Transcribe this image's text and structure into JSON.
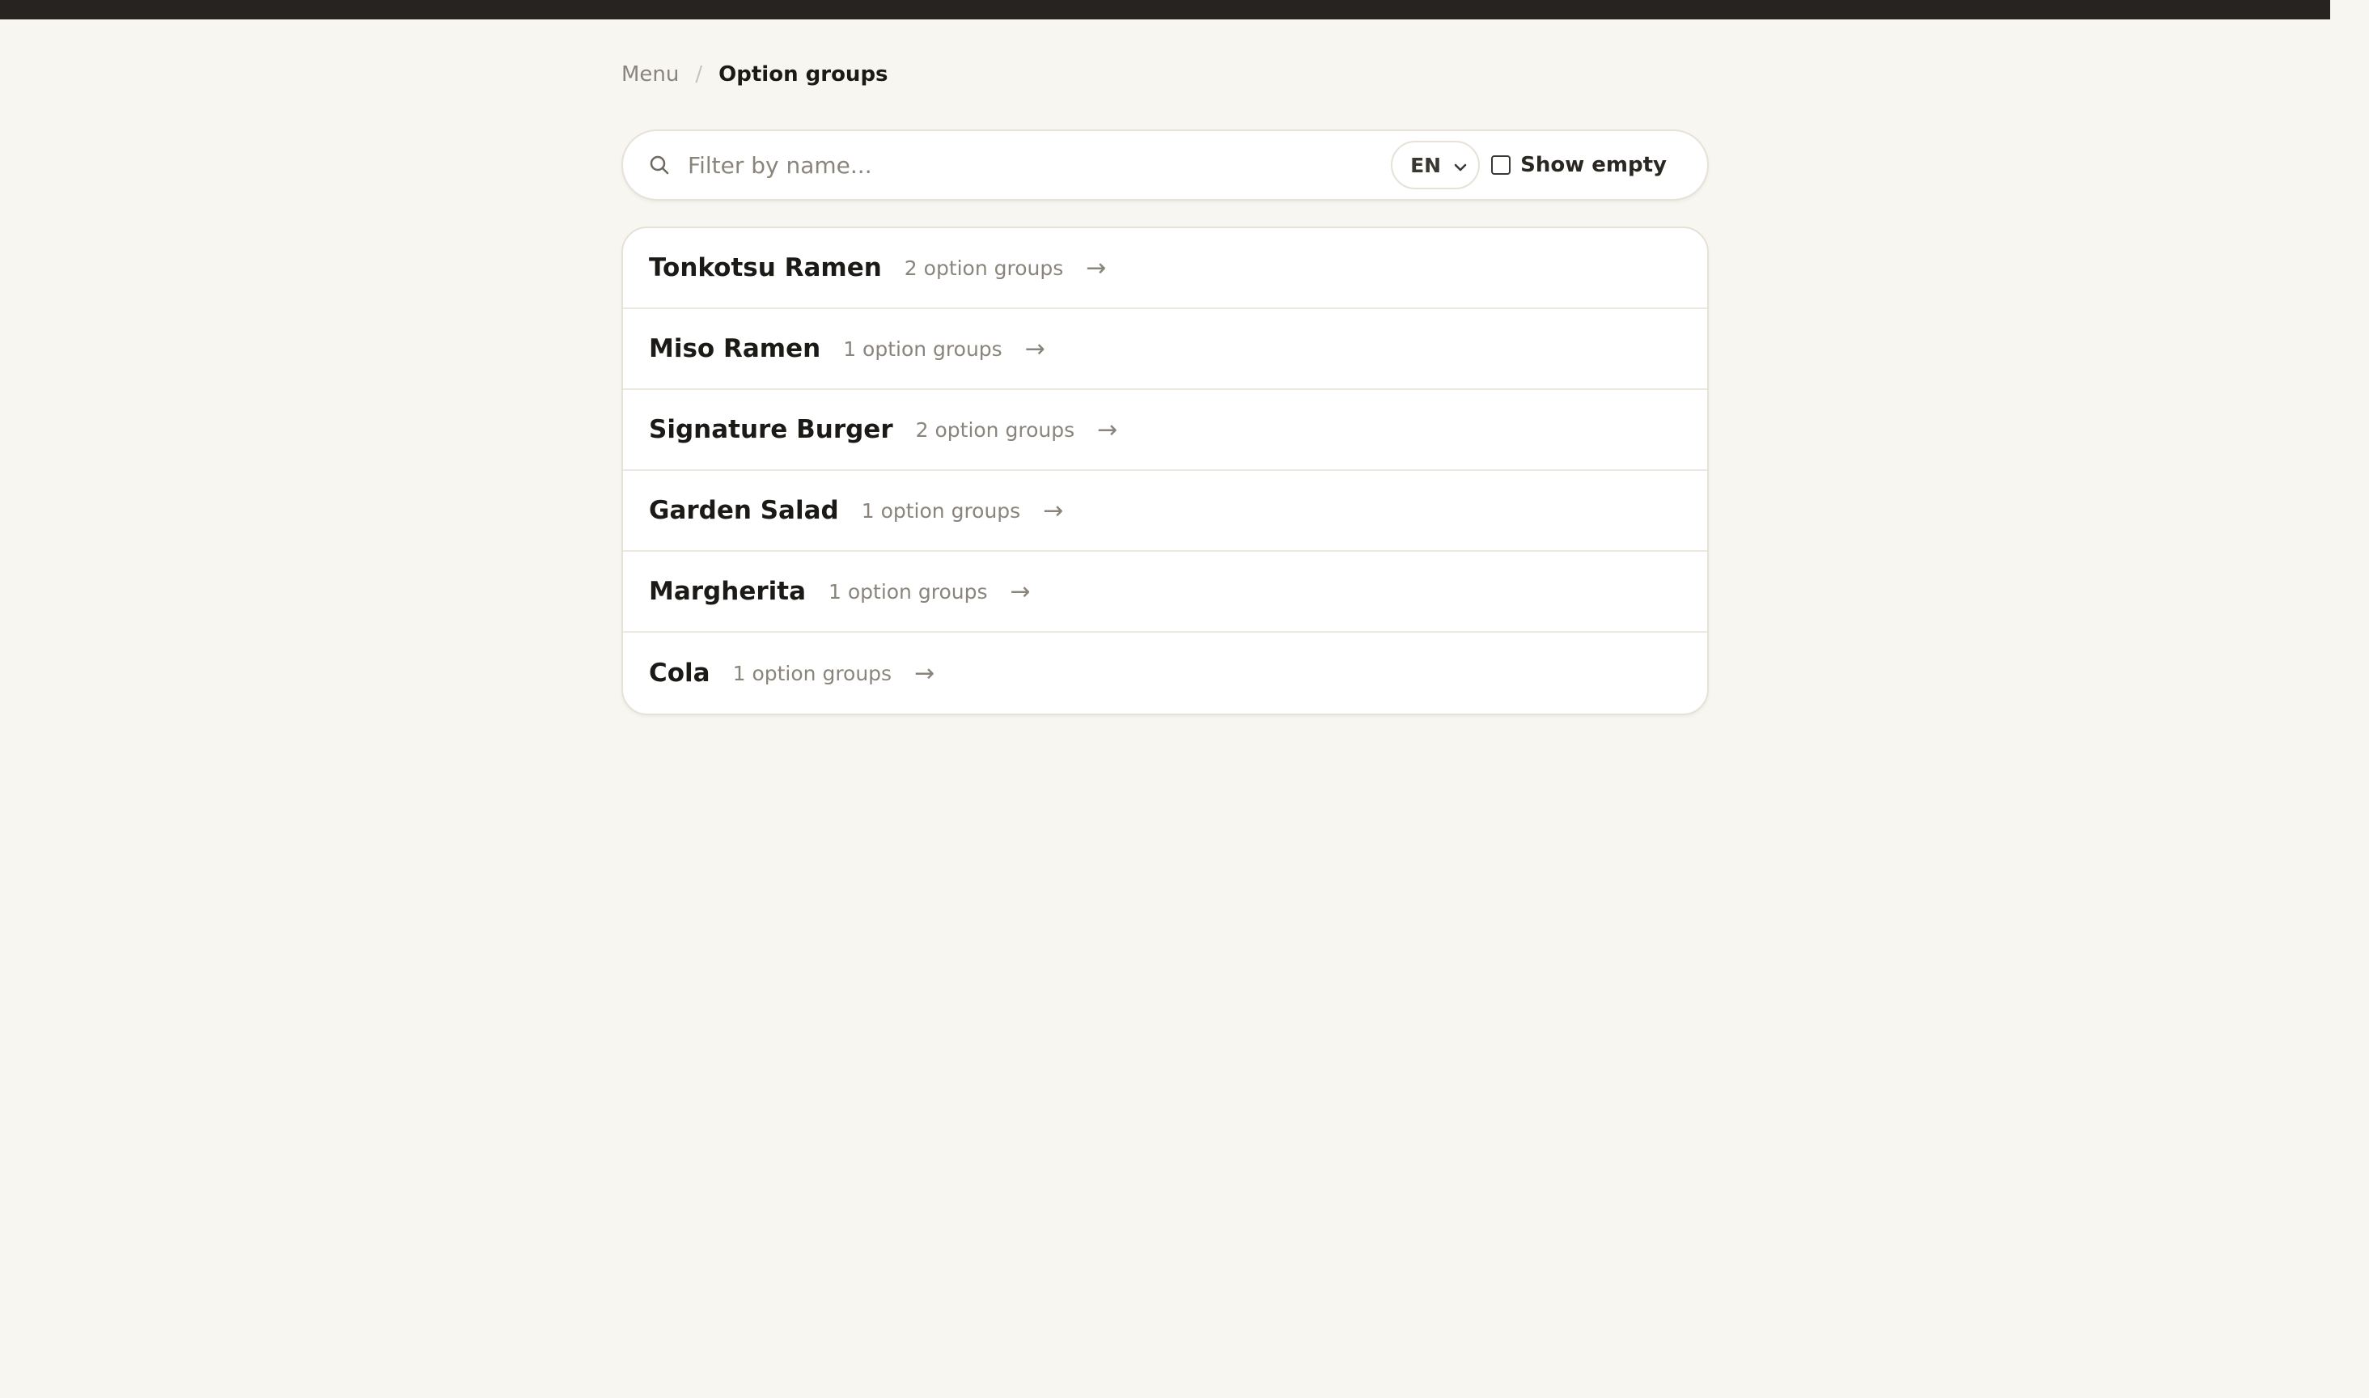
{
  "breadcrumb": {
    "parent": "Menu",
    "separator": "/",
    "current": "Option groups"
  },
  "filter": {
    "placeholder": "Filter by name...",
    "value": "",
    "language": "EN",
    "show_empty_label": "Show empty",
    "show_empty_checked": false
  },
  "items": [
    {
      "name": "Tonkotsu Ramen",
      "count_label": "2 option groups",
      "arrow": "→"
    },
    {
      "name": "Miso Ramen",
      "count_label": "1 option groups",
      "arrow": "→"
    },
    {
      "name": "Signature Burger",
      "count_label": "2 option groups",
      "arrow": "→"
    },
    {
      "name": "Garden Salad",
      "count_label": "1 option groups",
      "arrow": "→"
    },
    {
      "name": "Margherita",
      "count_label": "1 option groups",
      "arrow": "→"
    },
    {
      "name": "Cola",
      "count_label": "1 option groups",
      "arrow": "→"
    }
  ],
  "colors": {
    "background": "#f8f6f0",
    "topbar": "#262320",
    "text": "#1c1a17",
    "muted": "#8a857c"
  },
  "icons": {
    "search": "search-icon",
    "select": "chevron-down-icon",
    "row": "arrow-right-icon"
  }
}
